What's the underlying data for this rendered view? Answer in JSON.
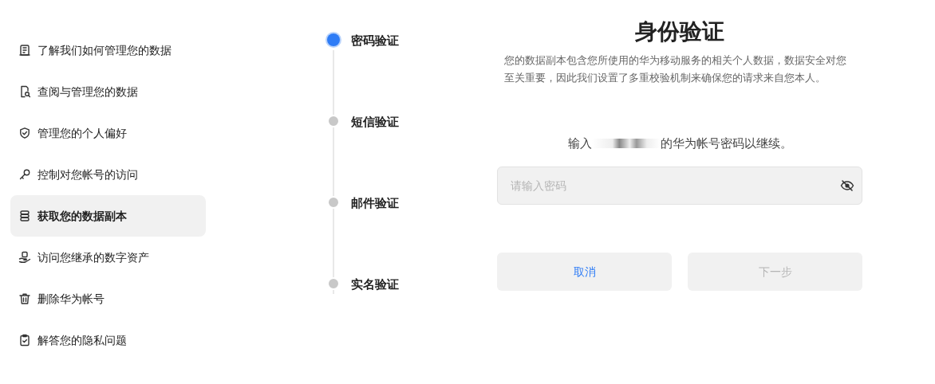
{
  "sidebar": {
    "items": [
      {
        "label": "了解我们如何管理您的数据",
        "selected": false
      },
      {
        "label": "查阅与管理您的数据",
        "selected": false
      },
      {
        "label": "管理您的个人偏好",
        "selected": false
      },
      {
        "label": "控制对您帐号的访问",
        "selected": false
      },
      {
        "label": "获取您的数据副本",
        "selected": true
      },
      {
        "label": "访问您继承的数字资产",
        "selected": false
      },
      {
        "label": "删除华为帐号",
        "selected": false
      },
      {
        "label": "解答您的隐私问题",
        "selected": false
      }
    ]
  },
  "steps": [
    {
      "label": "密码验证",
      "selected": true
    },
    {
      "label": "短信验证",
      "selected": false
    },
    {
      "label": "邮件验证",
      "selected": false
    },
    {
      "label": "实名验证",
      "selected": false
    }
  ],
  "panel": {
    "title": "身份验证",
    "description": "您的数据副本包含您所使用的华为移动服务的相关个人数据，数据安全对您至关重要，因此我们设置了多重校验机制来确保您的请求来自您本人。",
    "prompt_before": "输入",
    "prompt_after": "的华为帐号密码以继续。",
    "password": {
      "placeholder": "请输入密码"
    },
    "buttons": [
      {
        "label": "取消",
        "disabled": false
      },
      {
        "label": "下一步",
        "disabled": true
      }
    ]
  }
}
